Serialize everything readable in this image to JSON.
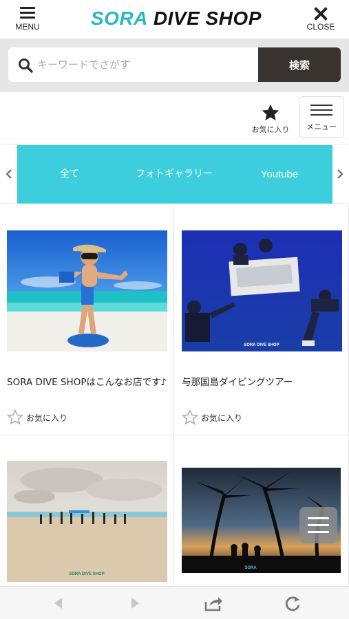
{
  "header": {
    "menu_label": "MENU",
    "close_label": "CLOSE",
    "logo_part1": "SORA",
    "logo_part2": "DIVE SHOP",
    "logo_color": "#2bb6c4"
  },
  "search": {
    "placeholder": "キーワードでさがす",
    "button_label": "検索",
    "button_color": "#3a3431"
  },
  "toolbar": {
    "favorites_label": "お気に入り",
    "menu_label": "メニュー"
  },
  "tabs": {
    "background_color": "#3ccedd",
    "items": [
      {
        "label": "全て"
      },
      {
        "label": "フォトギャラリー"
      },
      {
        "label": "Youtube"
      }
    ]
  },
  "cards": [
    {
      "title": "SORA DIVE SHOPはこんなお店です♪",
      "favorite_label": "お気に入り",
      "image": "woman-beach-snorkel-photo"
    },
    {
      "title": "与那国島ダイビングツアー",
      "favorite_label": "お気に入り",
      "image": "underwater-divers-banner-photo",
      "image_caption": "SORA DIVE SHOP"
    },
    {
      "title": "",
      "image": "beach-group-jumping-photo",
      "image_caption": "SORA DIVE SHOP"
    },
    {
      "title": "",
      "image": "palm-trees-sunset-photo",
      "image_caption": "SORA"
    }
  ],
  "icons": {
    "menu": "hamburger-icon",
    "close": "close-icon",
    "search": "search-icon",
    "favorite": "star-icon",
    "back": "back-arrow-icon",
    "forward": "forward-arrow-icon",
    "share": "share-icon",
    "reload": "reload-icon"
  }
}
